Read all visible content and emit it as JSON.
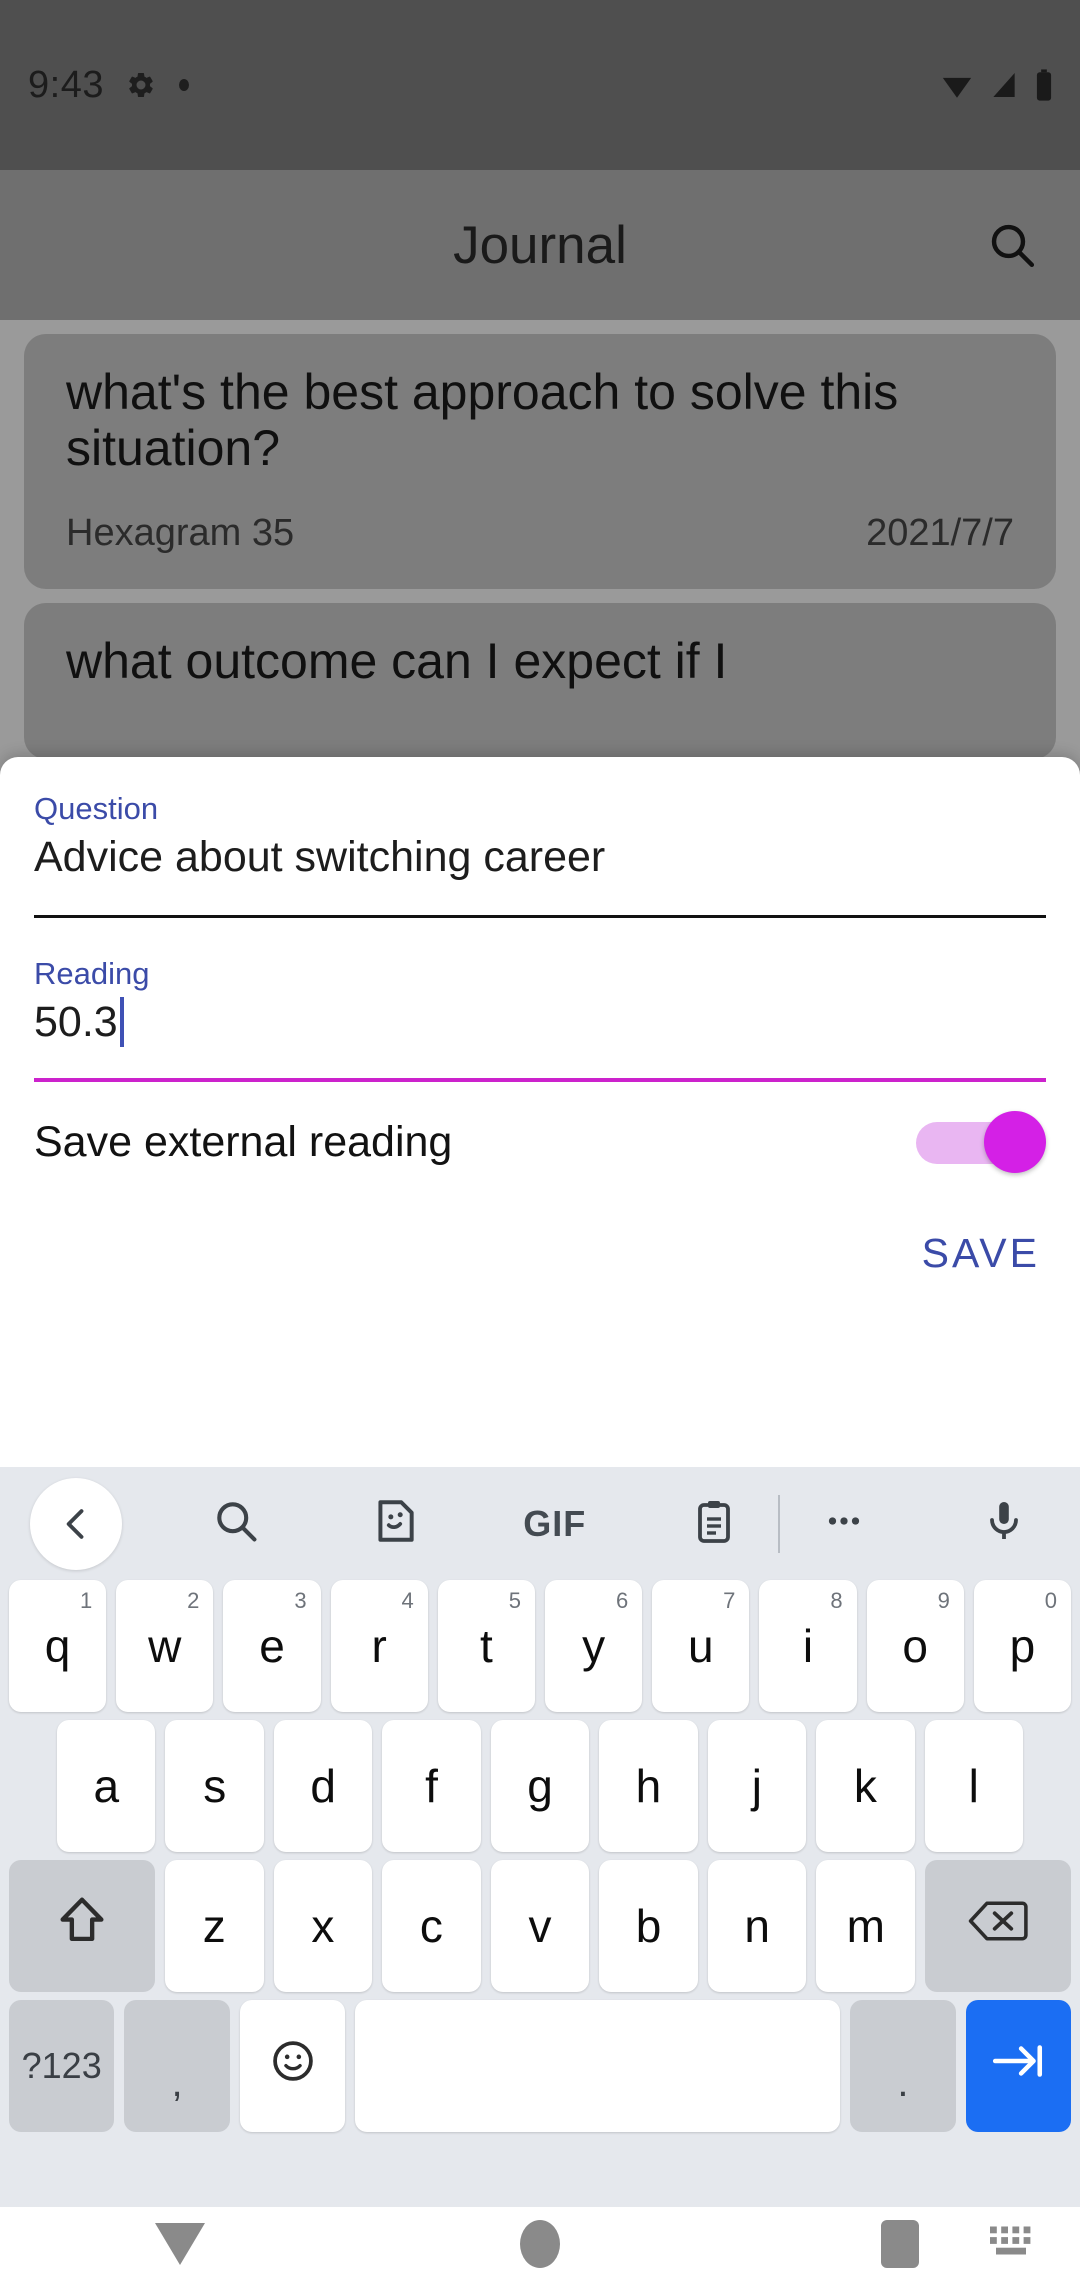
{
  "status_bar": {
    "time": "9:43",
    "icons_left": [
      "gear-icon",
      "dot-icon"
    ],
    "icons_right": [
      "wifi-icon",
      "signal-icon",
      "battery-icon"
    ]
  },
  "app_bar": {
    "title": "Journal",
    "search_icon": "search-icon"
  },
  "journal": {
    "cards": [
      {
        "question": "what's the best approach to solve this situation?",
        "hexagram": "Hexagram 35",
        "date": "2021/7/7"
      },
      {
        "question": "what outcome can I expect if I",
        "hexagram": "",
        "date": ""
      }
    ]
  },
  "sheet": {
    "question_label": "Question",
    "question_value": "Advice about switching career",
    "reading_label": "Reading",
    "reading_value": "50.3",
    "switch_label": "Save external reading",
    "switch_on": true,
    "save_label": "SAVE",
    "accent_color": "#cc22cc",
    "label_color": "#3b4ba8"
  },
  "keyboard": {
    "toolbar": [
      {
        "name": "back-icon",
        "label": ""
      },
      {
        "name": "search-icon",
        "label": ""
      },
      {
        "name": "sticker-icon",
        "label": ""
      },
      {
        "name": "gif-icon",
        "label": "GIF"
      },
      {
        "name": "clipboard-icon",
        "label": ""
      },
      {
        "name": "more-options-icon",
        "label": ""
      },
      {
        "name": "microphone-icon",
        "label": ""
      }
    ],
    "row1": [
      {
        "key": "q",
        "sup": "1"
      },
      {
        "key": "w",
        "sup": "2"
      },
      {
        "key": "e",
        "sup": "3"
      },
      {
        "key": "r",
        "sup": "4"
      },
      {
        "key": "t",
        "sup": "5"
      },
      {
        "key": "y",
        "sup": "6"
      },
      {
        "key": "u",
        "sup": "7"
      },
      {
        "key": "i",
        "sup": "8"
      },
      {
        "key": "o",
        "sup": "9"
      },
      {
        "key": "p",
        "sup": "0"
      }
    ],
    "row2": [
      {
        "key": "a"
      },
      {
        "key": "s"
      },
      {
        "key": "d"
      },
      {
        "key": "f"
      },
      {
        "key": "g"
      },
      {
        "key": "h"
      },
      {
        "key": "j"
      },
      {
        "key": "k"
      },
      {
        "key": "l"
      }
    ],
    "row3": [
      {
        "key": "z"
      },
      {
        "key": "x"
      },
      {
        "key": "c"
      },
      {
        "key": "v"
      },
      {
        "key": "b"
      },
      {
        "key": "n"
      },
      {
        "key": "m"
      }
    ],
    "shift_key": "shift-icon",
    "backspace_key": "backspace-icon",
    "row4": {
      "symbols": "?123",
      "comma": ",",
      "emoji": "emoji-icon",
      "space": "",
      "period": ".",
      "enter": "next-arrow-icon"
    }
  },
  "nav_bar": {
    "back": "down-triangle-icon",
    "home": "home-circle-icon",
    "recents": "recents-square-icon",
    "keyboard_switch": "keyboard-switch-icon"
  }
}
